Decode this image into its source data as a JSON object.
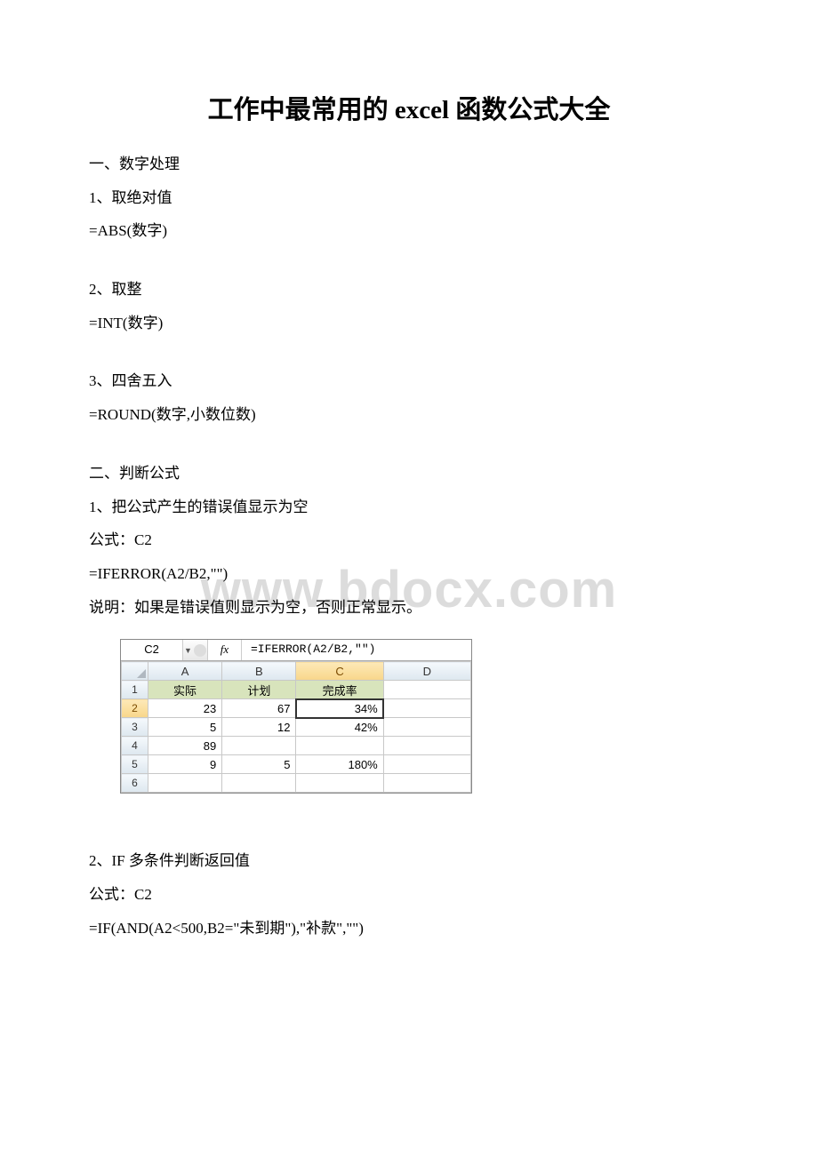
{
  "title": "工作中最常用的 excel 函数公式大全",
  "watermark": "www.bdocx.com",
  "sections": {
    "s1_heading": "一、数字处理",
    "s1_1_label": "1、取绝对值",
    "s1_1_formula": "=ABS(数字)",
    "s1_2_label": "2、取整",
    "s1_2_formula": "=INT(数字)",
    "s1_3_label": "3、四舍五入",
    "s1_3_formula": "=ROUND(数字,小数位数)",
    "s2_heading": "二、判断公式",
    "s2_1_label": "1、把公式产生的错误值显示为空",
    "s2_1_cell": "公式：C2",
    "s2_1_formula": "=IFERROR(A2/B2,\"\")",
    "s2_1_note": "说明：如果是错误值则显示为空，否则正常显示。",
    "s2_2_label": "2、IF 多条件判断返回值",
    "s2_2_cell": "公式：C2",
    "s2_2_formula": "=IF(AND(A2<500,B2=\"未到期\"),\"补款\",\"\")"
  },
  "excel": {
    "name_box": "C2",
    "fx": "fx",
    "formula": "=IFERROR(A2/B2,\"\")",
    "col_headers": [
      "A",
      "B",
      "C",
      "D"
    ],
    "row_headers": [
      "1",
      "2",
      "3",
      "4",
      "5",
      "6"
    ],
    "data_headers": [
      "实际",
      "计划",
      "完成率"
    ],
    "rows": [
      {
        "a": "23",
        "b": "67",
        "c": "34%"
      },
      {
        "a": "5",
        "b": "12",
        "c": "42%"
      },
      {
        "a": "89",
        "b": "",
        "c": ""
      },
      {
        "a": "9",
        "b": "5",
        "c": "180%"
      }
    ]
  }
}
